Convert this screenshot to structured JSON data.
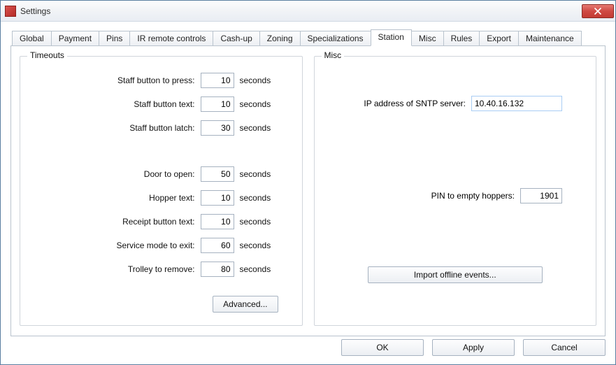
{
  "window": {
    "title": "Settings"
  },
  "tabs": {
    "items": [
      {
        "label": "Global"
      },
      {
        "label": "Payment"
      },
      {
        "label": "Pins"
      },
      {
        "label": "IR remote controls"
      },
      {
        "label": "Cash-up"
      },
      {
        "label": "Zoning"
      },
      {
        "label": "Specializations"
      },
      {
        "label": "Station"
      },
      {
        "label": "Misc"
      },
      {
        "label": "Rules"
      },
      {
        "label": "Export"
      },
      {
        "label": "Maintenance"
      }
    ],
    "active_index": 7
  },
  "groups": {
    "timeouts": {
      "title": "Timeouts",
      "rows": [
        {
          "label": "Staff button to press:",
          "value": "10",
          "unit": "seconds"
        },
        {
          "label": "Staff button text:",
          "value": "10",
          "unit": "seconds"
        },
        {
          "label": "Staff button latch:",
          "value": "30",
          "unit": "seconds"
        },
        {
          "label": "Door to open:",
          "value": "50",
          "unit": "seconds"
        },
        {
          "label": "Hopper text:",
          "value": "10",
          "unit": "seconds"
        },
        {
          "label": "Receipt  button text:",
          "value": "10",
          "unit": "seconds"
        },
        {
          "label": "Service mode to exit:",
          "value": "60",
          "unit": "seconds"
        },
        {
          "label": "Trolley to remove:",
          "value": "80",
          "unit": "seconds"
        }
      ],
      "advanced_label": "Advanced..."
    },
    "misc": {
      "title": "Misc",
      "sntp_label": "IP address of SNTP server:",
      "sntp_value": "10.40.16.132",
      "pin_label": "PIN to empty hoppers:",
      "pin_value": "1901",
      "import_label": "Import offline events..."
    }
  },
  "buttons": {
    "ok": "OK",
    "apply": "Apply",
    "cancel": "Cancel"
  }
}
